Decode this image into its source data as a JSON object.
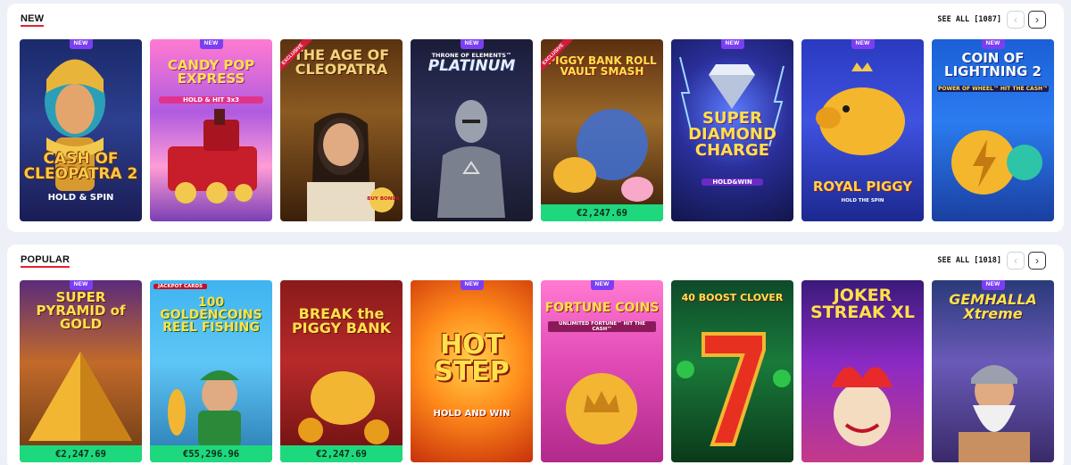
{
  "sections": {
    "new": {
      "title": "NEW",
      "see_all": "SEE ALL [1087]",
      "games": [
        {
          "title": "CASH OF CLEOPATRA 2",
          "subtitle": "HOLD & SPIN",
          "badge": "NEW",
          "jackpot": ""
        },
        {
          "title": "CANDY POP EXPRESS",
          "subtitle": "HOLD & HIT 3x3",
          "badge": "NEW",
          "jackpot": ""
        },
        {
          "title": "THE AGE OF CLEOPATRA",
          "subtitle": "BUY BONUS",
          "badge": "EXCLUSIVE",
          "jackpot": ""
        },
        {
          "title": "PLATINUM",
          "subtitle": "THRONE OF ELEMENTS™",
          "badge": "NEW",
          "jackpot": ""
        },
        {
          "title": "PIGGY BANK ROLL VAULT SMASH",
          "subtitle": "",
          "badge": "EXCLUSIVE",
          "jackpot": "€2,247.69"
        },
        {
          "title": "SUPER DIAMOND CHARGE",
          "subtitle": "HOLD&WIN",
          "badge": "NEW",
          "jackpot": ""
        },
        {
          "title": "ROYAL PIGGY",
          "subtitle": "HOLD THE SPIN",
          "badge": "NEW",
          "jackpot": ""
        },
        {
          "title": "COIN OF LIGHTNING 2",
          "subtitle": "POWER OF WHEEL™ HIT THE CASH™",
          "badge": "NEW",
          "jackpot": ""
        }
      ]
    },
    "popular": {
      "title": "POPULAR",
      "see_all": "SEE ALL [1018]",
      "games": [
        {
          "title": "SUPER PYRAMID of GOLD",
          "subtitle": "",
          "badge": "NEW",
          "jackpot": "€2,247.69"
        },
        {
          "title": "100 GOLDENCOINS REEL FISHING",
          "subtitle": "JACKPOT CARDS",
          "badge": "",
          "jackpot": "€55,296.96"
        },
        {
          "title": "BREAK the PIGGY BANK",
          "subtitle": "",
          "badge": "",
          "jackpot": "€2,247.69"
        },
        {
          "title": "HOT STEP",
          "subtitle": "HOLD AND WIN",
          "badge": "NEW",
          "jackpot": ""
        },
        {
          "title": "FORTUNE COINS",
          "subtitle": "UNLIMITED FORTUNE™ HIT THE CASH™",
          "badge": "NEW",
          "jackpot": ""
        },
        {
          "title": "40 BOOST CLOVER",
          "subtitle": "",
          "badge": "",
          "jackpot": ""
        },
        {
          "title": "JOKER STREAK XL",
          "subtitle": "",
          "badge": "",
          "jackpot": ""
        },
        {
          "title": "GEMHALLA Xtreme",
          "subtitle": "",
          "badge": "NEW",
          "jackpot": ""
        }
      ]
    }
  },
  "colors": {
    "accent": "#e8212f",
    "new_badge": "#7b3ff2",
    "jackpot": "#1ed87e"
  }
}
